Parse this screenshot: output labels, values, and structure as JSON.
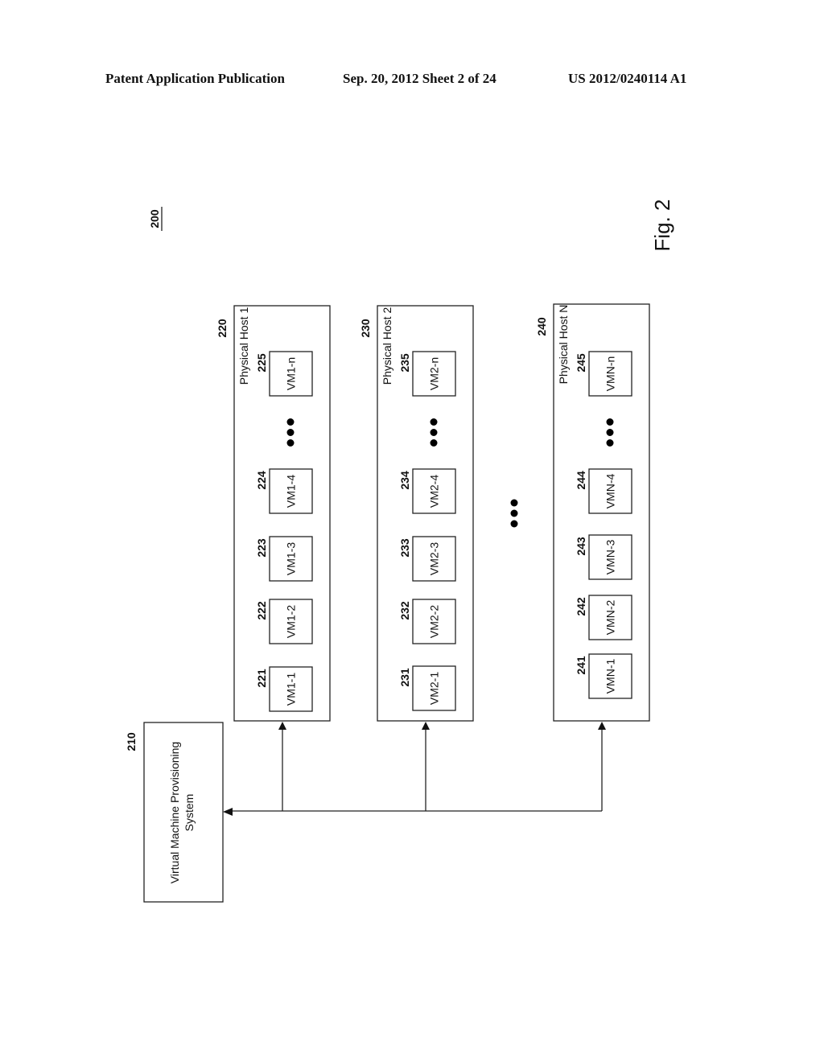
{
  "header": {
    "publication": "Patent Application Publication",
    "date_sheet": "Sep. 20, 2012   Sheet 2 of 24",
    "patent_number": "US 2012/0240114 A1"
  },
  "figure": {
    "number_ref": "200",
    "caption": "Fig. 2"
  },
  "provisioning_system": {
    "ref": "210",
    "label_line1": "Virtual Machine Provisioning",
    "label_line2": "System"
  },
  "hosts": [
    {
      "ref": "220",
      "label": "Physical Host 1",
      "vms": [
        {
          "ref": "221",
          "label": "VM1-1"
        },
        {
          "ref": "222",
          "label": "VM1-2"
        },
        {
          "ref": "223",
          "label": "VM1-3"
        },
        {
          "ref": "224",
          "label": "VM1-4"
        },
        {
          "ref": "225",
          "label": "VM1-n"
        }
      ]
    },
    {
      "ref": "230",
      "label": "Physical Host 2",
      "vms": [
        {
          "ref": "231",
          "label": "VM2-1"
        },
        {
          "ref": "232",
          "label": "VM2-2"
        },
        {
          "ref": "233",
          "label": "VM2-3"
        },
        {
          "ref": "234",
          "label": "VM2-4"
        },
        {
          "ref": "235",
          "label": "VM2-n"
        }
      ]
    },
    {
      "ref": "240",
      "label": "Physical Host N",
      "vms": [
        {
          "ref": "241",
          "label": "VMN-1"
        },
        {
          "ref": "242",
          "label": "VMN-2"
        },
        {
          "ref": "243",
          "label": "VMN-3"
        },
        {
          "ref": "244",
          "label": "VMN-4"
        },
        {
          "ref": "245",
          "label": "VMN-n"
        }
      ]
    }
  ]
}
